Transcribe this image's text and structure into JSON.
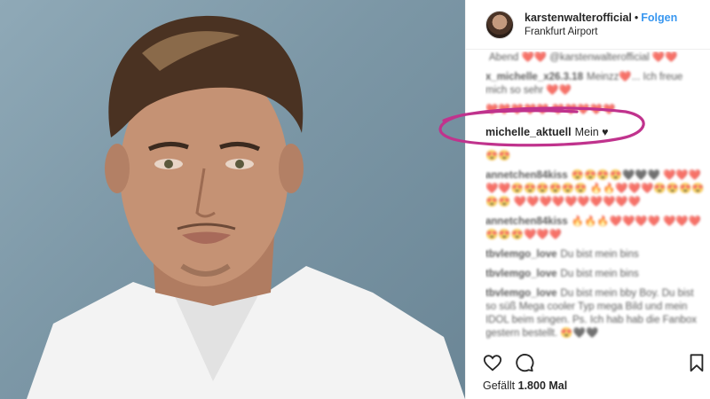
{
  "post": {
    "username": "karstenwalterofficial",
    "separator": "•",
    "follow_label": "Folgen",
    "location": "Frankfurt Airport"
  },
  "comments": [
    {
      "user": "",
      "text": "Abend ❤️❤️ @karstenwalterofficial ❤️❤️"
    },
    {
      "user": "x_michelle_x26.3.18",
      "text": "Meinzz❤️... Ich freue mich so sehr ❤️❤️"
    },
    {
      "user": "",
      "text": "❤️❤️❤️❤️❤️ ❤️❤️❤️❤️❤️"
    },
    {
      "user": "michelle_aktuell",
      "text": "Mein ♥"
    },
    {
      "user": "",
      "text": "😍😍"
    },
    {
      "user": "annetchen84kiss",
      "text": "😍😍😍😍🖤🖤🖤 ❤️❤️❤️❤️❤️😍😍😍😍😍😍 🔥🔥❤️❤️❤️😍😍😍😍😍😍 ❤️❤️❤️❤️❤️❤️❤️❤️❤️❤️"
    },
    {
      "user": "annetchen84kiss",
      "text": "🔥🔥🔥❤️❤️❤️❤️ ❤️❤️❤️😍😍😍❤️❤️❤️"
    },
    {
      "user": "tbvlemgo_love",
      "text": "Du bist mein bins"
    },
    {
      "user": "tbvlemgo_love",
      "text": "Du bist mein bins"
    },
    {
      "user": "tbvlemgo_love",
      "text": "Du bist mein bby Boy. Du bist so süß Mega cooler Typ mega Bild und mein IDOL beim singen. Ps. Ich hab hab die Fanbox gestern bestellt. 😍🖤🖤"
    }
  ],
  "likes": {
    "label": "Gefällt",
    "count": "1.800",
    "suffix": "Mal"
  },
  "icons": [
    "heart-icon",
    "comment-icon",
    "bookmark-icon"
  ],
  "colors": {
    "follow": "#3897f0",
    "annotation": "#c0338d"
  }
}
